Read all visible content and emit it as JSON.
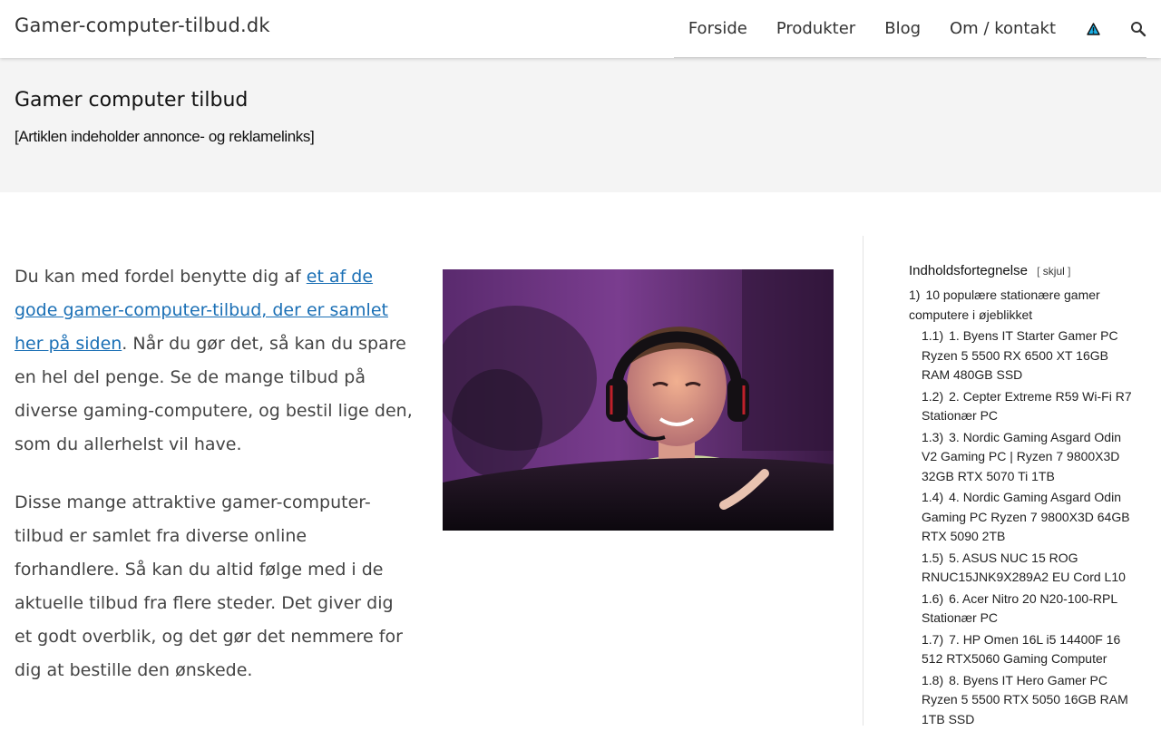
{
  "header": {
    "site_title": "Gamer-computer-tilbud.dk",
    "nav": [
      "Forside",
      "Produkter",
      "Blog",
      "Om / kontakt"
    ],
    "icons": {
      "alert": "warning-icon",
      "search": "search-icon"
    },
    "alert_color": "#1ab0e6"
  },
  "band": {
    "title": "Gamer computer tilbud",
    "disclaimer": "[Artiklen indeholder annonce- og reklamelinks]"
  },
  "main": {
    "p1_before": "Du kan med fordel benytte dig af ",
    "p1_link": "et af de gode gamer-computer-tilbud, der er samlet her på siden",
    "p1_after": ". Når du gør det, så kan du spare en hel del penge. Se de mange tilbud på diverse gaming-computere, og bestil lige den, som du allerhelst vil have.",
    "p2": "Disse mange attraktive gamer-computer-tilbud er samlet fra diverse online forhandlere. Så kan du altid følge med i de aktuelle tilbud fra flere steder. Det giver dig et godt overblik, og det gør det nemmere for dig at bestille den ønskede.",
    "link_color": "#1a6fb5"
  },
  "toc": {
    "title": "Indholdsfortegnelse",
    "toggle_open": "[",
    "toggle_label": "skjul",
    "toggle_close": "]",
    "items": [
      {
        "num": "1)",
        "text": "10 populære stationære gamer computere i øjeblikket",
        "sub": false
      },
      {
        "num": "1.1)",
        "text": "1. Byens IT Starter Gamer PC Ryzen 5 5500 RX 6500 XT 16GB RAM 480GB SSD",
        "sub": true
      },
      {
        "num": "1.2)",
        "text": "2. Cepter Extreme R59 Wi-Fi R7 Stationær PC",
        "sub": true
      },
      {
        "num": "1.3)",
        "text": "3. Nordic Gaming Asgard Odin V2 Gaming PC | Ryzen 7 9800X3D 32GB RTX 5070 Ti 1TB",
        "sub": true
      },
      {
        "num": "1.4)",
        "text": "4. Nordic Gaming Asgard Odin Gaming PC Ryzen 7 9800X3D 64GB RTX 5090 2TB",
        "sub": true
      },
      {
        "num": "1.5)",
        "text": "5. ASUS NUC 15 ROG RNUC15JNK9X289A2 EU Cord L10",
        "sub": true
      },
      {
        "num": "1.6)",
        "text": "6. Acer Nitro 20 N20-100-RPL Stationær PC",
        "sub": true
      },
      {
        "num": "1.7)",
        "text": "7. HP Omen 16L i5 14400F 16 512 RTX5060 Gaming Computer",
        "sub": true
      },
      {
        "num": "1.8)",
        "text": "8. Byens IT Hero Gamer PC Ryzen 5 5500 RTX 5050 16GB RAM 1TB SSD",
        "sub": true
      }
    ]
  }
}
